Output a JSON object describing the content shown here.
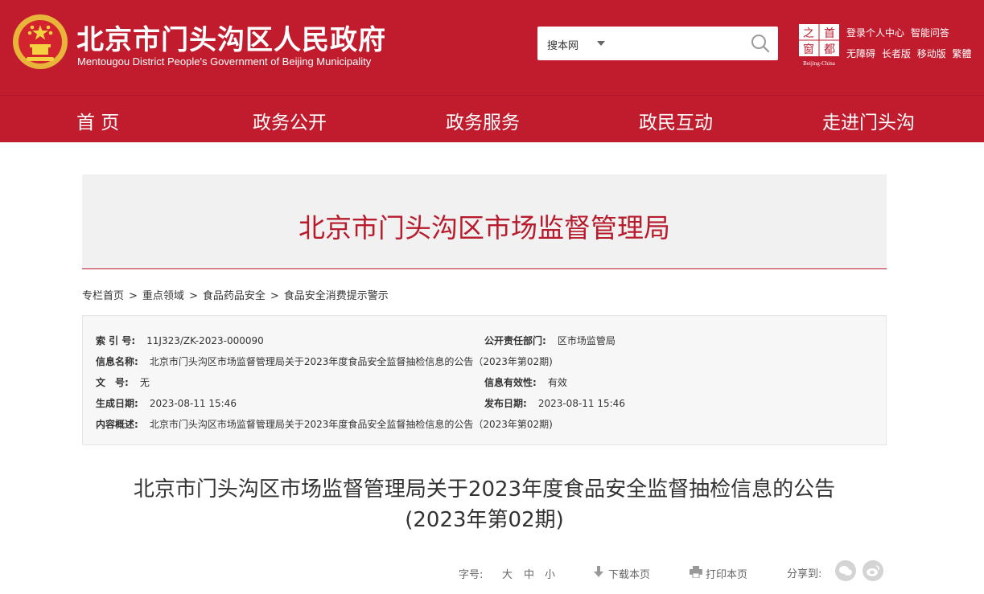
{
  "header": {
    "title": "北京市门头沟区人民政府",
    "subtitle": "Mentougou District People's Government of Beijing Municipality",
    "search": {
      "scope": "搜本网",
      "placeholder": ""
    },
    "capital_logo": {
      "chars": [
        "之",
        "首",
        "窗",
        "都"
      ],
      "caption": "Beijing-China"
    },
    "links_row1": [
      "登录个人中心",
      "智能问答"
    ],
    "links_row2": [
      "无障碍",
      "长者版",
      "移动版",
      "繁體"
    ]
  },
  "nav": {
    "items": [
      "首 页",
      "政务公开",
      "政务服务",
      "政民互动",
      "走进门头沟"
    ]
  },
  "banner": {
    "title": "北京市门头沟区市场监督管理局"
  },
  "breadcrumb": [
    "专栏首页",
    "重点领域",
    "食品药品安全",
    "食品安全消费提示警示"
  ],
  "info": {
    "index_label": "索 引 号:",
    "index_value": "11J323/ZK-2023-000090",
    "dept_label": "公开责任部门:",
    "dept_value": "区市场监管局",
    "name_label": "信息名称:",
    "name_value": "北京市门头沟区市场监督管理局关于2023年度食品安全监督抽检信息的公告（2023年第02期)",
    "doc_label": "文　号:",
    "doc_value": "无",
    "validity_label": "信息有效性:",
    "validity_value": "有效",
    "created_label": "生成日期:",
    "created_value": "2023-08-11 15:46",
    "published_label": "发布日期:",
    "published_value": "2023-08-11 15:46",
    "summary_label": "内容概述:",
    "summary_value": "北京市门头沟区市场监督管理局关于2023年度食品安全监督抽检信息的公告（2023年第02期)"
  },
  "article": {
    "title_line1": "北京市门头沟区市场监督管理局关于2023年度食品安全监督抽检信息的公告",
    "title_line2": "(2023年第02期)"
  },
  "tools": {
    "font_label": "字号:",
    "font_large": "大",
    "font_medium": "中",
    "font_small": "小",
    "download": "下载本页",
    "print": "打印本页",
    "share_label": "分享到:"
  },
  "colors": {
    "brand_red": "#c01c2e",
    "banner_title": "#b81c2c"
  }
}
